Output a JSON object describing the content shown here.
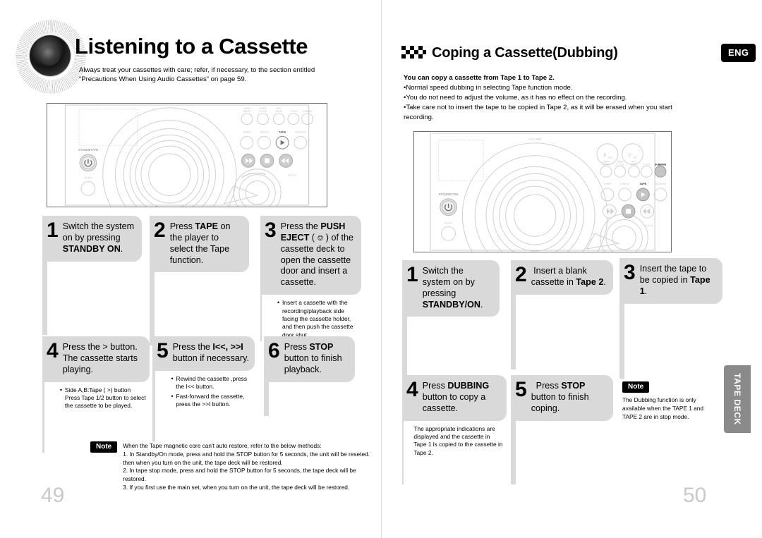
{
  "document": {
    "language_badge": "ENG",
    "side_tab": "TAPE DECK",
    "left_page_number": "49",
    "right_page_number": "50"
  },
  "left_page": {
    "title": "Listening to a Cassette",
    "subtitle": "Always treat your cassettes with care; refer, if necessary, to the section entitled “Precautions When Using Audio Cassettes” on page 59.",
    "speaker_icon": "speaker-icon",
    "device_labels": {
      "standby_on": "STANDBY/ON",
      "echo": "ECHO",
      "tape": "TAPE",
      "tuner": "TUNER",
      "dvd_cd": "DVD/CD",
      "aux_dvd": "AUX/DVD",
      "aux_in": "AUX IN"
    },
    "steps": [
      {
        "number": "1",
        "text_parts": [
          {
            "t": "Switch the system on by pressing ",
            "bold": false
          },
          {
            "t": "STANDBY ON",
            "bold": true
          },
          {
            "t": ".",
            "bold": false
          }
        ],
        "body": []
      },
      {
        "number": "2",
        "text_parts": [
          {
            "t": "Press ",
            "bold": false
          },
          {
            "t": "TAPE",
            "bold": true
          },
          {
            "t": " on the player to select the Tape function.",
            "bold": false
          }
        ],
        "body": []
      },
      {
        "number": "3",
        "text_parts": [
          {
            "t": "Press the ",
            "bold": false
          },
          {
            "t": "PUSH EJECT",
            "bold": true
          },
          {
            "t": " ( ⏏ ) of the cassette deck to open the cassette door and insert a cassette.",
            "bold": false
          }
        ],
        "body": [
          "Insert a cassette with the recording/playback side facing the cassette holder, and then push the cassette door shut."
        ]
      },
      {
        "number": "4",
        "text_parts": [
          {
            "t": "Press the > button. The cassette starts playing.",
            "bold": false
          }
        ],
        "body": [
          "Side A,B:Tape ( >) button Press Tape 1/2 button to select the cassette to be played."
        ]
      },
      {
        "number": "5",
        "text_parts": [
          {
            "t": "Press the ",
            "bold": false
          },
          {
            "t": "I<<, >>I",
            "bold": true
          },
          {
            "t": " button if necessary.",
            "bold": false
          }
        ],
        "body": [
          "Rewind the cassette ,press the I<< button.",
          "Fast-forward the cassette, press the >>I button."
        ]
      },
      {
        "number": "6",
        "text_parts": [
          {
            "t": "Press ",
            "bold": false
          },
          {
            "t": "STOP",
            "bold": true
          },
          {
            "t": " button to finish playback.",
            "bold": false
          }
        ],
        "body": []
      }
    ],
    "note": {
      "badge": "Note",
      "lines": [
        "When the Tape magnetic core can't auto restore, refer to the below methods:",
        "1. In Standby/On mode, press and hold the STOP button for 5 seconds, the unit will be reseted. then when you turn on the unit, the tape deck will be restored.",
        "2. In tape stop mode, press and hold the STOP button for 5 seconds, the tape deck will be restored.",
        "3. If you first use the main set, when you turn on the unit, the tape deck will be restored."
      ]
    }
  },
  "right_page": {
    "section_title": "Coping a Cassette(Dubbing)",
    "section_icon": "checkered-arrows-icon",
    "intro": {
      "lead": "You can copy a cassette from Tape 1 to Tape 2.",
      "bullets": [
        "Normal speed dubbing in selecting Tape function mode.",
        "You do not need to adjust the volume, as it has no effect on the recording.",
        "Take care not to insert the tape to be copied in Tape 2, as it will be erased when you start recording."
      ]
    },
    "device_labels": {
      "standby_on": "STANDBY/ON",
      "echo": "ECHO",
      "volume": "VOLUME",
      "dubbing": "DUBBING",
      "tape": "TAPE",
      "tuner": "TUNER",
      "dvd_cd": "DVD/CD",
      "aux_dvd": "AUX/DVD",
      "aux_in": "AUX IN"
    },
    "steps": [
      {
        "number": "1",
        "text_parts": [
          {
            "t": "Switch the system on by pressing ",
            "bold": false
          },
          {
            "t": "STANDBY/ON",
            "bold": true
          },
          {
            "t": ".",
            "bold": false
          }
        ],
        "body": []
      },
      {
        "number": "2",
        "text_parts": [
          {
            "t": "Insert a blank cassette in ",
            "bold": false
          },
          {
            "t": "Tape 2",
            "bold": true
          },
          {
            "t": ".",
            "bold": false
          }
        ],
        "body": []
      },
      {
        "number": "3",
        "text_parts": [
          {
            "t": "Insert the tape to be copied in ",
            "bold": false
          },
          {
            "t": "Tape 1",
            "bold": true
          },
          {
            "t": ".",
            "bold": false
          }
        ],
        "body": []
      },
      {
        "number": "4",
        "text_parts": [
          {
            "t": "Press ",
            "bold": false
          },
          {
            "t": "DUBBING",
            "bold": true
          },
          {
            "t": " button to copy a cassette.",
            "bold": false
          }
        ],
        "body": [
          "The appropriate indications are displayed and the cassette in Tape 1 is copied to the cassette  in Tape 2."
        ]
      },
      {
        "number": "5",
        "text_parts": [
          {
            "t": " Press ",
            "bold": false
          },
          {
            "t": "STOP",
            "bold": true
          },
          {
            "t": " button to finish coping.",
            "bold": false
          }
        ],
        "body": []
      }
    ],
    "note": {
      "badge": "Note",
      "lines": [
        "The Dubbing function is only available when the TAPE 1 and TAPE 2 are in stop mode."
      ]
    }
  }
}
